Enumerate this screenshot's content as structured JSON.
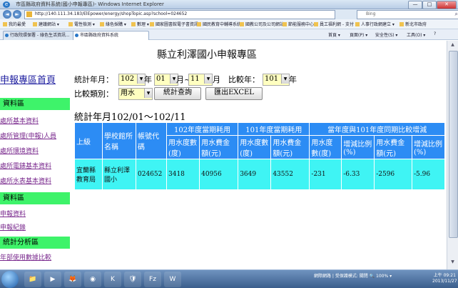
{
  "window": {
    "title": "市區縣政府資料系統(國小申報專區)- Windows Internet Explorer",
    "minimize": "—",
    "maximize": "□",
    "close": "✕"
  },
  "browser": {
    "back": "◄",
    "forward": "►",
    "address": "http://140.111.34.183/ElEpower/energy/shopTopic.asp?school=024652",
    "search_placeholder": "Bing",
    "search_icon": "magnifier-icon",
    "favorites": [
      "我的最愛",
      "建議網站 ▾",
      "電性檢測 ▾",
      "綠色採購 ▾",
      "數理 ▾",
      "國家圖書館電子書資訊",
      "國民教育中輔導系統",
      "國教公司及公司網站",
      "節能服務中心",
      "員工福利網 - 支付",
      "人事行政網建立 ▾",
      "新北市政府"
    ],
    "tabs": [
      {
        "label": "行政院環保署 - 綠色生活資訊...",
        "active": false
      },
      {
        "label": "市區縣政府資料系統",
        "active": true
      }
    ],
    "commands": [
      "首頁 ▾",
      "頁面(P) ▾",
      "安全性(S) ▾",
      "工具(O) ▾",
      "?"
    ]
  },
  "page": {
    "title": "縣立利澤國小申報專區",
    "home_link": "申報專區首頁",
    "sidebar": [
      {
        "type": "header",
        "label": "資料區"
      },
      {
        "type": "link",
        "label": "處所基本資料"
      },
      {
        "type": "link",
        "label": "處所管理(申報)人員"
      },
      {
        "type": "link",
        "label": "處所環境資料"
      },
      {
        "type": "link",
        "label": "處所電錶基本資料"
      },
      {
        "type": "link",
        "label": "處所水表基本資料"
      },
      {
        "type": "header",
        "label": "資料區"
      },
      {
        "type": "link",
        "label": "申報資料"
      },
      {
        "type": "link",
        "label": "申報紀錄"
      },
      {
        "type": "header",
        "label": "統計分析區"
      },
      {
        "type": "link",
        "label": "年部使用數據比較"
      }
    ],
    "filters": {
      "stat_month_label": "統計年月：",
      "year_value": "102",
      "year_suffix": "年",
      "month_from": "01",
      "month_sep": "月~",
      "month_to": "11",
      "month_suffix": "月",
      "compare_year_label": "比較年：",
      "compare_year_value": "101",
      "compare_year_suffix": "年",
      "compare_type_label": "比較類別：",
      "compare_type_value": "用水",
      "query_button": "統計查詢",
      "export_button": "匯出EXCEL",
      "dropdown_icon": "chevron-down-icon"
    },
    "stats_heading": "統計年月102/01～102/11",
    "table": {
      "group_headers": [
        "102年度當期耗用",
        "101年度當期耗用",
        "當年度與101年度同期比較增減"
      ],
      "fixed_headers": [
        "上級",
        "學校館所名稱",
        "帳號代碼"
      ],
      "sub_headers": [
        "用水度數(度)",
        "用水費金額(元)",
        "用水度數(度)",
        "用水費金額(元)",
        "用水度數(度)",
        "增減比例(%)",
        "用水費金額(元)",
        "增減比例(%)"
      ],
      "rows": [
        [
          "宜蘭縣教育局",
          "縣立利澤國小",
          "024652",
          "3418",
          "40956",
          "3649",
          "43552",
          "-231",
          "-6.33",
          "-2596",
          "-5.96"
        ]
      ]
    }
  },
  "taskbar": {
    "items": [
      "📁",
      "▶",
      "🦊",
      "◉",
      "K",
      "🛡",
      "Fz",
      "W"
    ],
    "tray": "網際網路 | 受保護模式: 關閉   🔍 100% ▾",
    "time": "上午 09:21",
    "date": "2013/11/27"
  }
}
